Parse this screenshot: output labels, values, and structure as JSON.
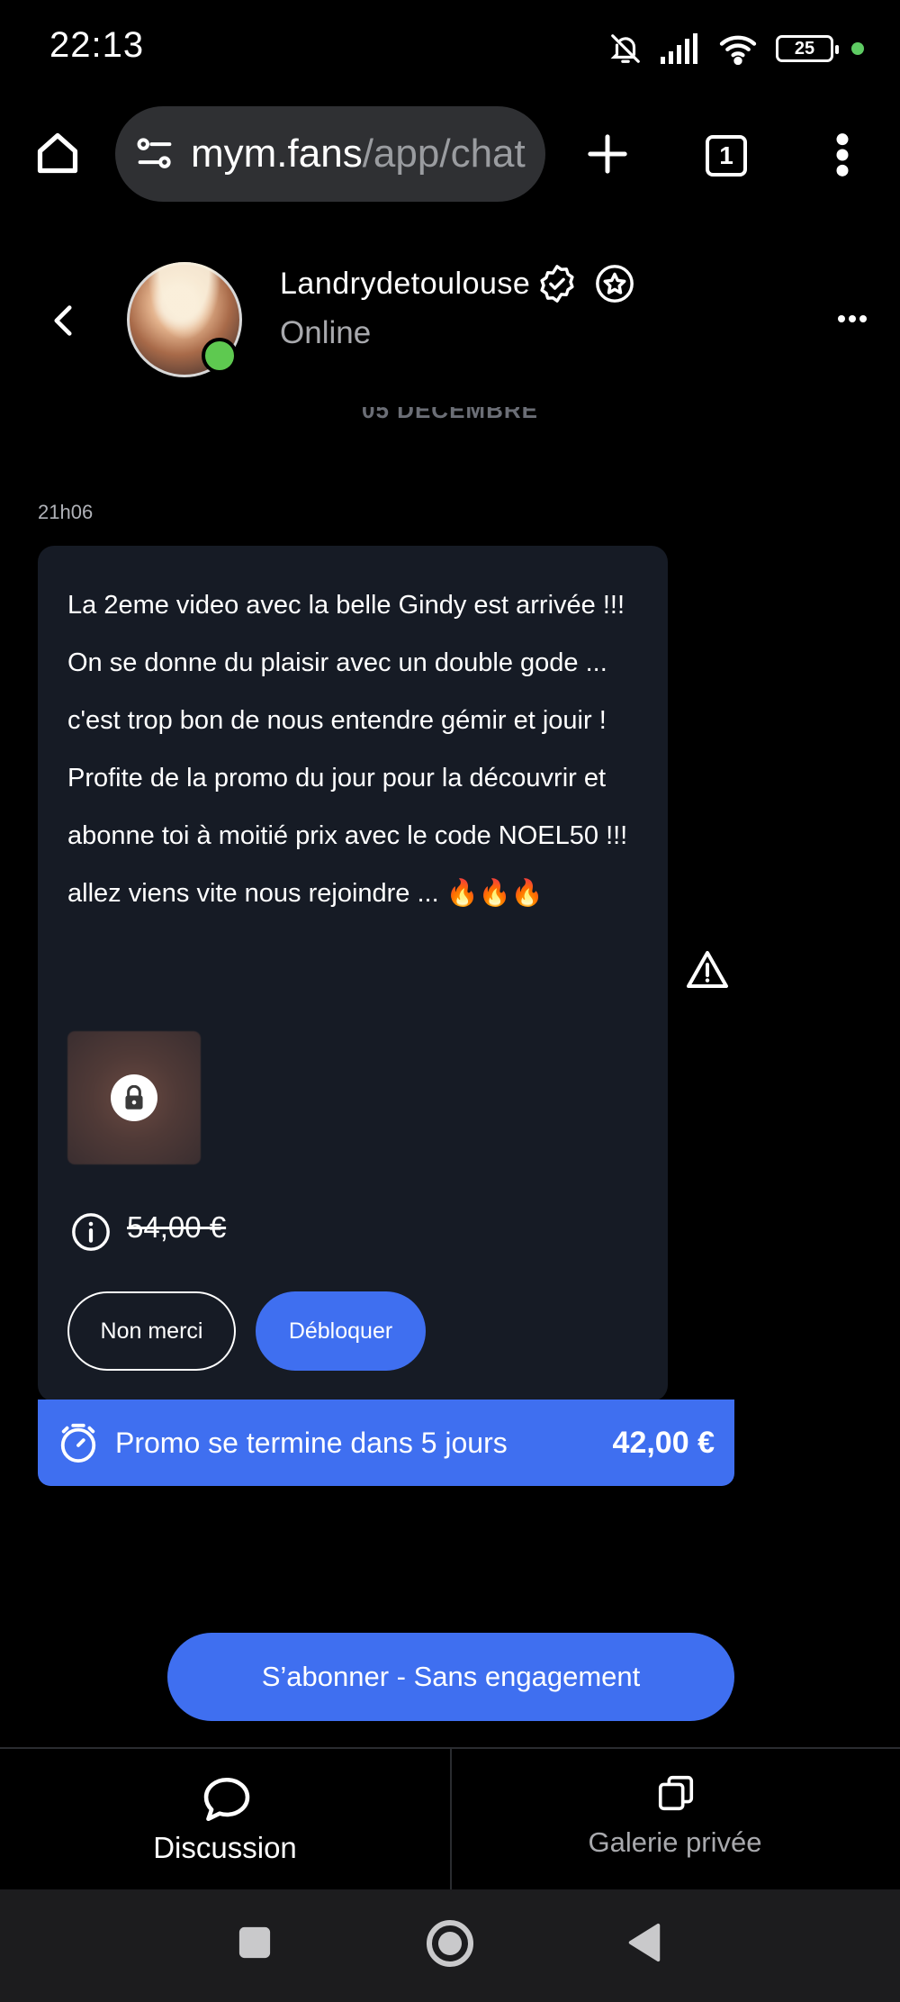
{
  "status_bar": {
    "time": "22:13",
    "battery": "25",
    "icons": [
      "bell-off-icon",
      "signal-icon",
      "wifi-icon",
      "battery-icon",
      "privacy-dot"
    ]
  },
  "browser": {
    "url_domain": "mym.fans",
    "url_path": "/app/chat",
    "tab_count": "1"
  },
  "chat_header": {
    "name": "Landrydetoulouse",
    "status": "Online"
  },
  "date_separator": "05 DÉCEMBRE",
  "message": {
    "time": "21h06",
    "text": "La 2eme video avec la belle Gindy est arrivée !!! On se donne du plaisir avec un double gode ... c'est trop bon de nous entendre gémir et jouir ! Profite de la promo du jour pour la découvrir et abonne toi à moitié prix avec le code NOEL50 !!! allez viens vite nous rejoindre ... 🔥🔥🔥",
    "original_price": "54,00 €",
    "decline_label": "Non merci",
    "unlock_label": "Débloquer"
  },
  "promo": {
    "text": "Promo se termine dans 5 jours",
    "price": "42,00 €"
  },
  "subscribe_label": "S’abonner - Sans engagement",
  "bottom_nav": {
    "discussion": "Discussion",
    "gallery": "Galerie privée"
  },
  "colors": {
    "accent": "#3f6ff0",
    "bubble": "#161b25",
    "online": "#5ec950"
  }
}
